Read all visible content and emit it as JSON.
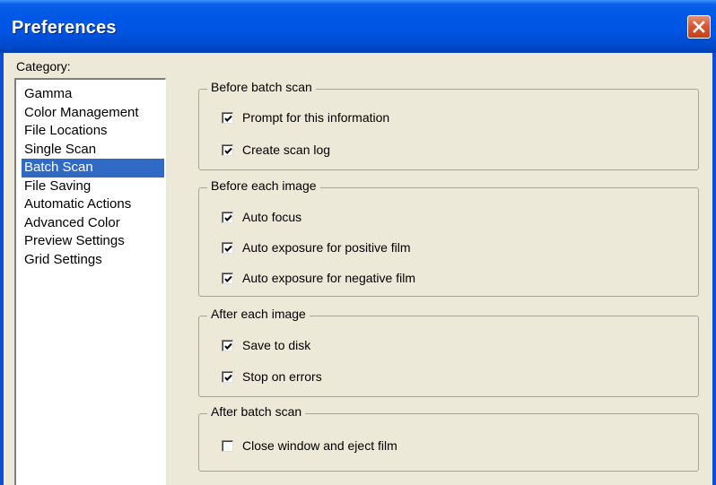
{
  "window": {
    "title": "Preferences"
  },
  "category": {
    "label": "Category:",
    "items": [
      "Gamma",
      "Color Management",
      "File Locations",
      "Single Scan",
      "Batch Scan",
      "File Saving",
      "Automatic Actions",
      "Advanced Color",
      "Preview Settings",
      "Grid Settings"
    ],
    "selected": "Batch Scan"
  },
  "groups": {
    "before_batch": {
      "title": "Before batch scan",
      "options": [
        {
          "label": "Prompt for this information",
          "checked": true
        },
        {
          "label": "Create scan log",
          "checked": true
        }
      ]
    },
    "before_image": {
      "title": "Before each image",
      "options": [
        {
          "label": "Auto focus",
          "checked": true
        },
        {
          "label": "Auto exposure for positive film",
          "checked": true
        },
        {
          "label": "Auto exposure for negative film",
          "checked": true
        }
      ]
    },
    "after_image": {
      "title": "After each image",
      "options": [
        {
          "label": "Save to disk",
          "checked": true
        },
        {
          "label": "Stop on errors",
          "checked": true
        }
      ]
    },
    "after_batch": {
      "title": "After batch scan",
      "options": [
        {
          "label": "Close window and eject film",
          "checked": false
        }
      ]
    }
  },
  "icons": {
    "close": "close-icon",
    "check": "checkmark-icon"
  },
  "colors": {
    "title_bar": "#0054e3",
    "selection": "#316ac5",
    "close_button": "#d8582f"
  }
}
